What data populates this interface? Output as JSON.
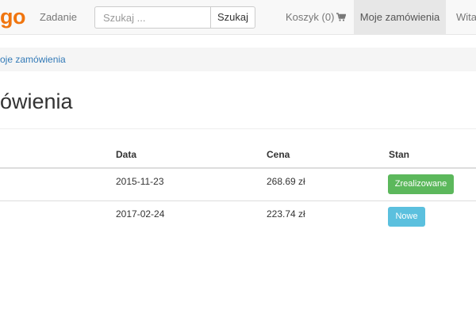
{
  "brand": {
    "text": "go"
  },
  "nav": {
    "task_link": "Zadanie",
    "search_placeholder": "Szukaj ...",
    "search_button": "Szukaj",
    "cart_label": "Koszyk (0)",
    "orders_link": "Moje zamówienia",
    "welcome_link": "Witaj"
  },
  "breadcrumb": {
    "current": "oje zamówienia"
  },
  "page": {
    "title": "ówienia"
  },
  "table": {
    "headers": {
      "date": "Data",
      "price": "Cena",
      "status": "Stan"
    },
    "rows": [
      {
        "date": "2015-11-23",
        "price": "268.69 zł",
        "status": "Zrealizowane",
        "status_color": "#5cb85c"
      },
      {
        "date": "2017-02-24",
        "price": "223.74 zł",
        "status": "Nowe",
        "status_color": "#5bc0de"
      }
    ]
  },
  "colors": {
    "brand": "#f0750f",
    "link": "#337ab7",
    "success": "#5cb85c",
    "info": "#5bc0de"
  },
  "icons": {
    "cart": "shopping-cart-icon"
  }
}
